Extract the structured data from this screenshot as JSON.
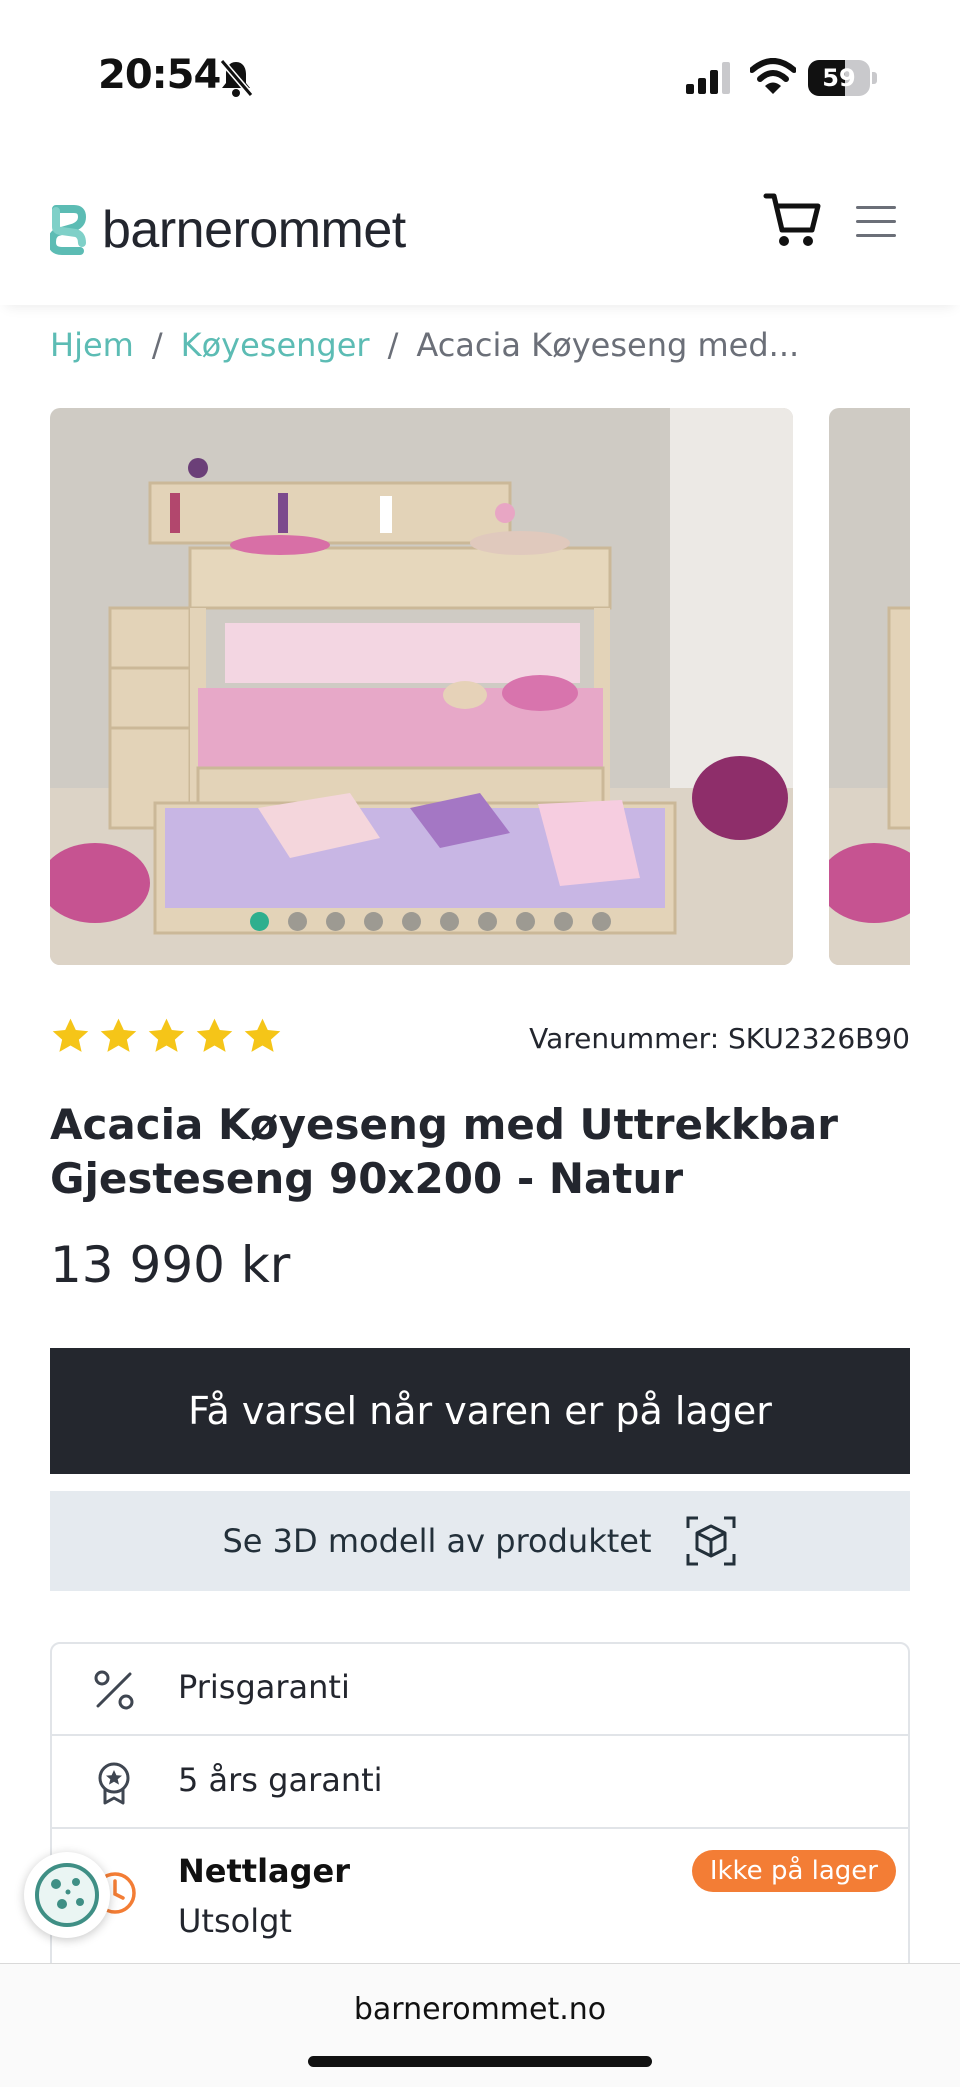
{
  "status_bar": {
    "time": "20:54",
    "battery_text": "59",
    "battery_level": 0.59
  },
  "header": {
    "logo_text": "barnerommet",
    "icons": [
      "cart-icon",
      "menu-icon"
    ],
    "logo_color": "#5cbcb4"
  },
  "breadcrumb": {
    "items": [
      "Hjem",
      "Køyesenger"
    ],
    "separator": "/",
    "current": "Acacia Køyeseng med..."
  },
  "gallery": {
    "slide_count": 10,
    "active_index": 0
  },
  "product": {
    "rating": 5,
    "sku_text": "Varenummer: SKU2326B90",
    "title": "Acacia Køyeseng med Uttrekkbar Gjesteseng 90x200 - Natur",
    "price": "13 990 kr"
  },
  "actions": {
    "notify_label": "Få varsel når varen er på lager",
    "model_label": "Se 3D modell av produktet"
  },
  "info": {
    "price_guarantee": "Prisgaranti",
    "warranty": "5 års garanti",
    "stock_title": "Nettlager",
    "stock_status": "Utsolgt",
    "stock_badge": "Ikke på lager",
    "badge_color": "#f37d35"
  },
  "browser": {
    "url": "barnerommet.no"
  },
  "colors": {
    "accent": "#5cbcb4",
    "dark_button": "#24272e",
    "light_button": "#e5eaef",
    "star": "#f5c518",
    "active_dot": "#2eaf8e"
  }
}
